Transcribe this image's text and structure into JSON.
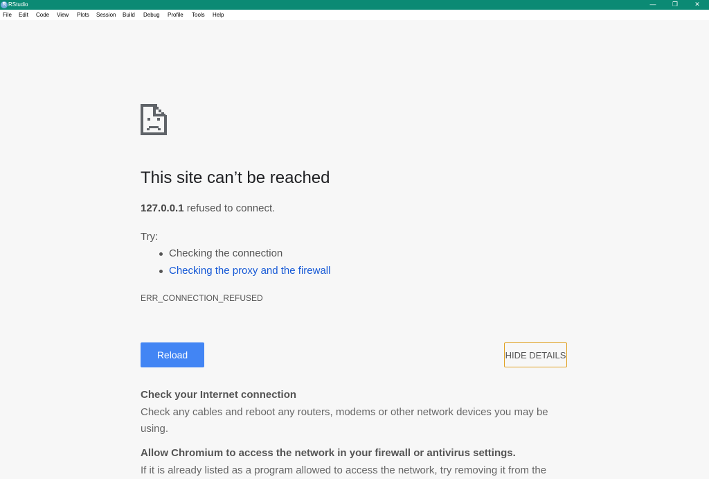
{
  "window": {
    "app_icon_letter": "R",
    "title": "RStudio",
    "controls": {
      "minimize": "—",
      "maximize": "❐",
      "close": "✕"
    }
  },
  "menu": [
    "File",
    "Edit",
    "Code",
    "View",
    "Plots",
    "Session",
    "Build",
    "Debug",
    "Profile",
    "Tools",
    "Help"
  ],
  "error_page": {
    "heading": "This site can’t be reached",
    "host": "127.0.0.1",
    "host_suffix": " refused to connect.",
    "try_label": "Try:",
    "suggestions": [
      "Checking the connection",
      "Checking the proxy and the firewall"
    ],
    "error_code": "ERR_CONNECTION_REFUSED",
    "reload_label": "Reload",
    "details_label": "HIDE DETAILS",
    "details": [
      {
        "heading": "Check your Internet connection",
        "body": "Check any cables and reboot any routers, modems or other network devices you may be using."
      },
      {
        "heading": "Allow Chromium to access the network in your firewall or antivirus settings.",
        "body": "If it is already listed as a program allowed to access the network, try removing it from the"
      }
    ]
  },
  "colors": {
    "titlebar": "#0b8a74",
    "link": "#1558d6",
    "reload_button": "#4285f4",
    "focus_outline": "#e0a020"
  }
}
